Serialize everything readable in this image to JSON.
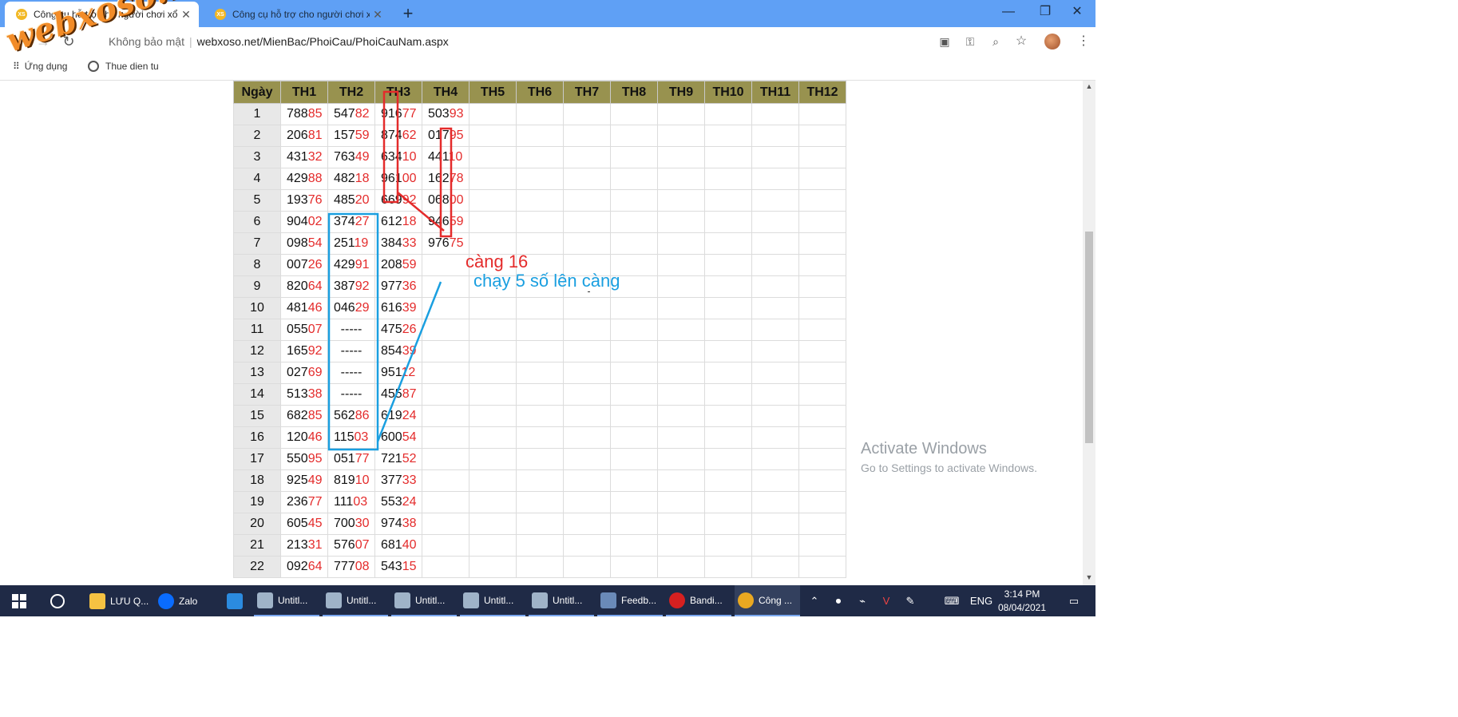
{
  "browser": {
    "tabs": [
      {
        "title": "Công cụ hỗ trợ cho người chơi xổ số",
        "favicon": "XS"
      },
      {
        "title": "Công cụ hỗ trợ cho người chơi xổ số",
        "favicon": "XS"
      }
    ],
    "new_tab_icon": "plus-icon",
    "window_controls": {
      "minimize": "—",
      "restore": "❐",
      "close": "✕"
    },
    "nav": {
      "back": "←",
      "forward": "→",
      "reload": "↻"
    },
    "address": {
      "security": "Không bảo mật",
      "url": "webxoso.net/MienBac/PhoiCau/PhoiCauNam.aspx"
    },
    "bookmarks": [
      {
        "label": "Ứng dụng",
        "icon": "apps-icon"
      },
      {
        "label": "Thue dien tu",
        "icon": "globe-icon"
      }
    ]
  },
  "watermark": "webxoso.net",
  "table": {
    "headers": [
      "Ngày",
      "TH1",
      "TH2",
      "TH3",
      "TH4",
      "TH5",
      "TH6",
      "TH7",
      "TH8",
      "TH9",
      "TH10",
      "TH11",
      "TH12"
    ],
    "rows": [
      {
        "day": "1",
        "cells": [
          "78885",
          "54782",
          "91677",
          "50393"
        ]
      },
      {
        "day": "2",
        "cells": [
          "20681",
          "15759",
          "87462",
          "01795"
        ]
      },
      {
        "day": "3",
        "cells": [
          "43132",
          "76349",
          "63410",
          "44110"
        ]
      },
      {
        "day": "4",
        "cells": [
          "42988",
          "48218",
          "96100",
          "16278"
        ]
      },
      {
        "day": "5",
        "cells": [
          "19376",
          "48520",
          "66992",
          "06800"
        ]
      },
      {
        "day": "6",
        "cells": [
          "90402",
          "37427",
          "61218",
          "94659"
        ]
      },
      {
        "day": "7",
        "cells": [
          "09854",
          "25119",
          "38433",
          "97675"
        ]
      },
      {
        "day": "8",
        "cells": [
          "00726",
          "42991",
          "20859",
          ""
        ]
      },
      {
        "day": "9",
        "cells": [
          "82064",
          "38792",
          "97736",
          ""
        ]
      },
      {
        "day": "10",
        "cells": [
          "48146",
          "04629",
          "61639",
          ""
        ]
      },
      {
        "day": "11",
        "cells": [
          "05507",
          "-----",
          "47526",
          ""
        ]
      },
      {
        "day": "12",
        "cells": [
          "16592",
          "-----",
          "85439",
          ""
        ]
      },
      {
        "day": "13",
        "cells": [
          "02769",
          "-----",
          "95112",
          ""
        ]
      },
      {
        "day": "14",
        "cells": [
          "51338",
          "-----",
          "45587",
          ""
        ]
      },
      {
        "day": "15",
        "cells": [
          "68285",
          "56286",
          "61924",
          ""
        ]
      },
      {
        "day": "16",
        "cells": [
          "12046",
          "11503",
          "60054",
          ""
        ]
      },
      {
        "day": "17",
        "cells": [
          "55095",
          "05177",
          "72152",
          ""
        ]
      },
      {
        "day": "18",
        "cells": [
          "92549",
          "81910",
          "37733",
          ""
        ]
      },
      {
        "day": "19",
        "cells": [
          "23677",
          "11103",
          "55324",
          ""
        ]
      },
      {
        "day": "20",
        "cells": [
          "60545",
          "70030",
          "97438",
          ""
        ]
      },
      {
        "day": "21",
        "cells": [
          "21331",
          "57607",
          "68140",
          ""
        ]
      },
      {
        "day": "22",
        "cells": [
          "09264",
          "77708",
          "54315",
          ""
        ]
      }
    ]
  },
  "annotations": {
    "cang": "càng 16",
    "chay": "chạy 5 số lên càng",
    "red_color": "#e42b2b",
    "blue_color": "#1a9fe0"
  },
  "activate_windows": {
    "title": "Activate Windows",
    "subtitle": "Go to Settings to activate Windows."
  },
  "taskbar": {
    "items": [
      {
        "label": "LƯU Q...",
        "icon": "folder-icon"
      },
      {
        "label": "Zalo",
        "icon": "zalo-icon"
      },
      {
        "label": "",
        "icon": "edge-icon"
      },
      {
        "label": "Untitl...",
        "icon": "paint-icon"
      },
      {
        "label": "Untitl...",
        "icon": "paint-icon"
      },
      {
        "label": "Untitl...",
        "icon": "paint-icon"
      },
      {
        "label": "Untitl...",
        "icon": "paint-icon"
      },
      {
        "label": "Untitl...",
        "icon": "paint-icon"
      },
      {
        "label": "Feedb...",
        "icon": "feedback-icon"
      },
      {
        "label": "Bandi...",
        "icon": "bandicam-icon"
      },
      {
        "label": "Công ...",
        "icon": "chrome-icon"
      }
    ],
    "language": "ENG",
    "time": "3:14 PM",
    "date": "08/04/2021"
  }
}
